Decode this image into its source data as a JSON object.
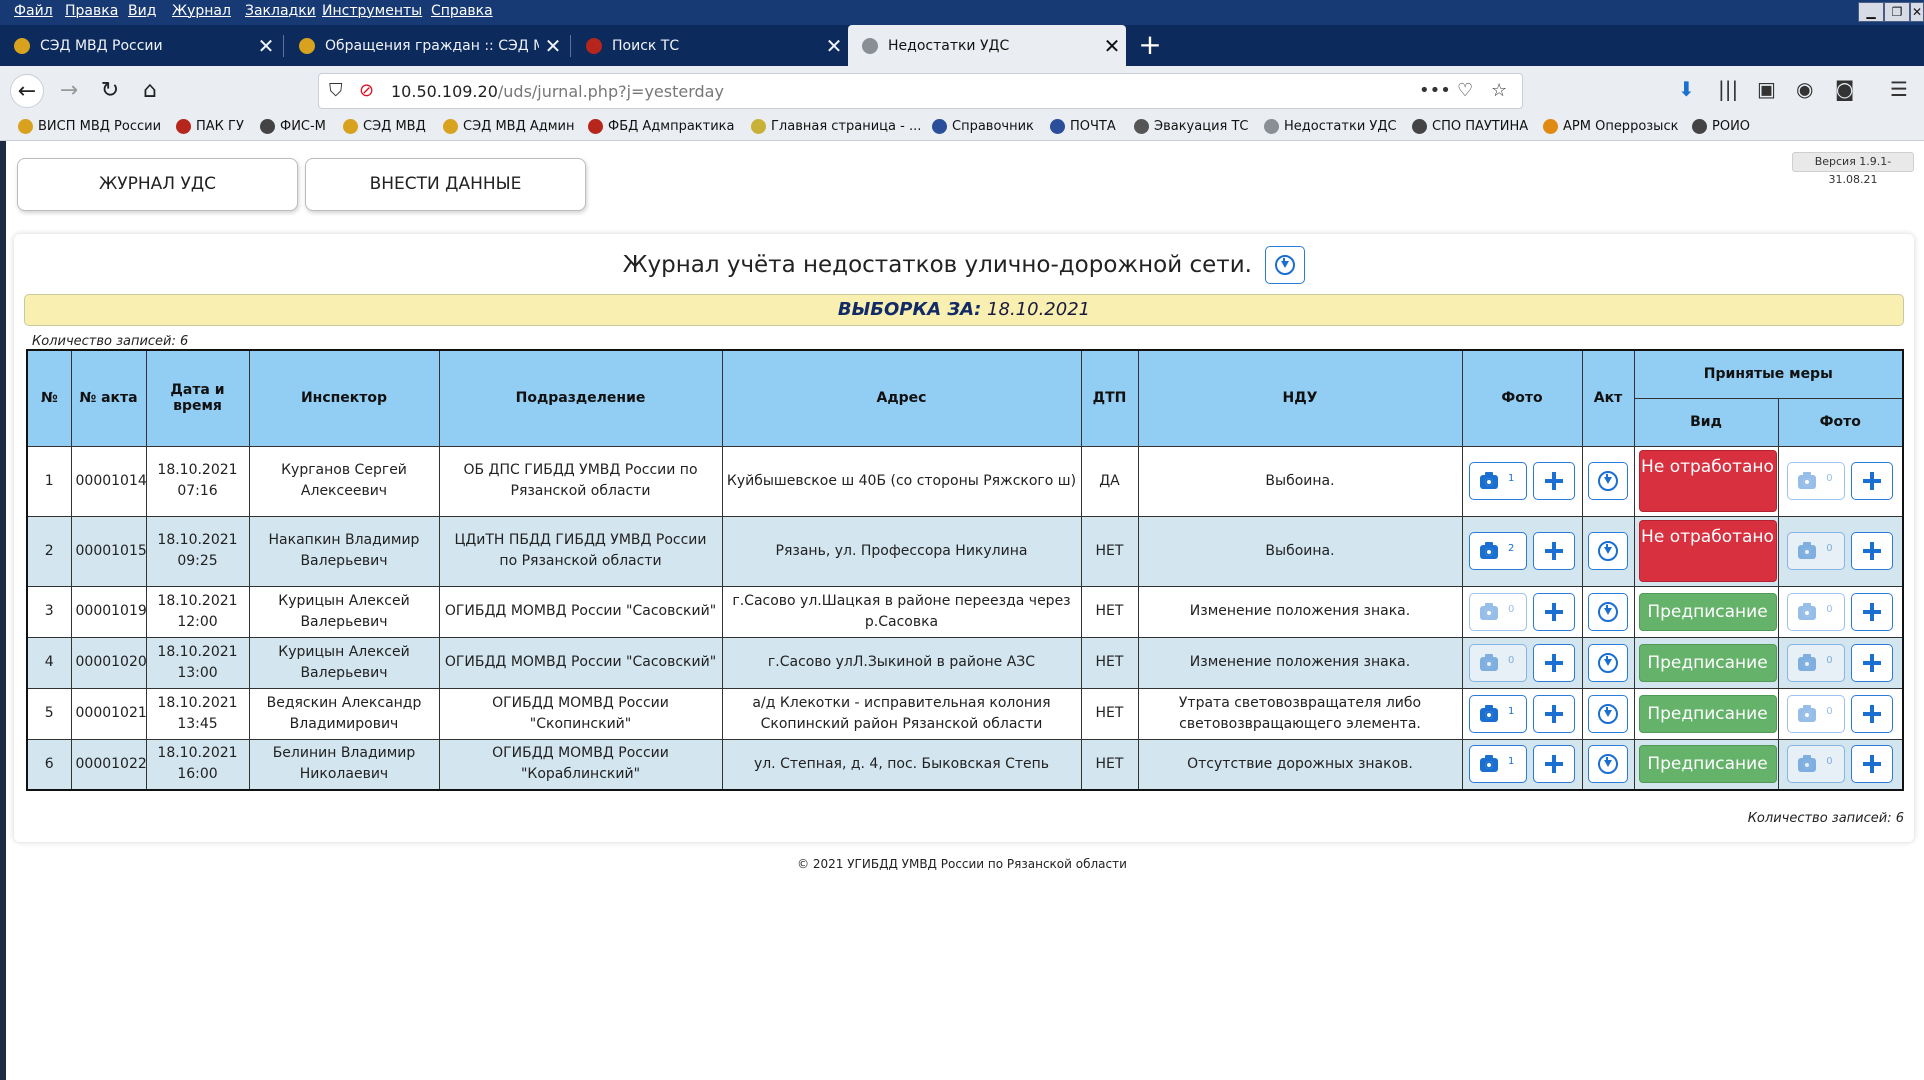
{
  "browser": {
    "menu": [
      "Файл",
      "Правка",
      "Вид",
      "Журнал",
      "Закладки",
      "Инструменты",
      "Справка"
    ],
    "tabs": [
      {
        "label": "СЭД МВД России",
        "icon": "emblem-icon"
      },
      {
        "label": "Обращения граждан :: СЭД МВД",
        "icon": "emblem-icon"
      },
      {
        "label": "Поиск ТС",
        "icon": "emblem-icon"
      },
      {
        "label": "Недостатки УДС",
        "icon": "road-icon"
      }
    ],
    "active_tab": 3,
    "url_host": "10.50.109.20",
    "url_path": "/uds/jurnal.php?j=yesterday",
    "bookmarks": [
      "ВИСП МВД России",
      "ПАК ГУ",
      "ФИС-М",
      "СЭД МВД",
      "СЭД МВД Админ",
      "ФБД Адмпрактика",
      "Главная страница - ...",
      "Справочник",
      "ПОЧТА",
      "Эвакуация ТС",
      "Недостатки УДС",
      "СПО ПАУТИНА",
      "АРМ Оперрозыск",
      "РОИО"
    ]
  },
  "page": {
    "version": "Версия 1.9.1-31.08.21",
    "nav_buttons": [
      "ЖУРНАЛ УДС",
      "ВНЕСТИ ДАННЫЕ"
    ],
    "title": "Журнал учёта недостатков улично-дорожной сети.",
    "period_label": "ВЫБОРКА ЗА:",
    "period_date": "18.10.2021",
    "count_text": "Количество записей: 6",
    "footer": "© 2021 УГИБДД УМВД России по Рязанской области"
  },
  "table": {
    "headers": {
      "num": "№",
      "act_no": "№ акта",
      "datetime": "Дата и время",
      "inspector": "Инспектор",
      "division": "Подразделение",
      "address": "Адрес",
      "dtp": "ДТП",
      "ndu": "НДУ",
      "photo": "Фото",
      "act": "Акт",
      "measures": "Принятые меры",
      "measures_kind": "Вид",
      "measures_photo": "Фото"
    },
    "rows": [
      {
        "num": "1",
        "act_no": "00001014",
        "date": "18.10.2021",
        "time": "07:16",
        "inspector": "Курганов Сергей Алексеевич",
        "division": "ОБ ДПС ГИБДД УМВД России по Рязанской области",
        "address": "Куйбышевское ш 40Б (со стороны Ряжского ш)",
        "dtp": "ДА",
        "ndu": "Выбоина.",
        "photo_count": "1",
        "status": "Не отработано",
        "status_kind": "red",
        "mphoto_count": "0"
      },
      {
        "num": "2",
        "act_no": "00001015",
        "date": "18.10.2021",
        "time": "09:25",
        "inspector": "Накапкин Владимир Валерьевич",
        "division": "ЦДиТН ПБДД ГИБДД УМВД России по Рязанской области",
        "address": "Рязань, ул. Профессора Никулина",
        "dtp": "НЕТ",
        "ndu": "Выбоина.",
        "photo_count": "2",
        "status": "Не отработано",
        "status_kind": "red",
        "mphoto_count": "0"
      },
      {
        "num": "3",
        "act_no": "00001019",
        "date": "18.10.2021",
        "time": "12:00",
        "inspector": "Курицын Алексей Валерьевич",
        "division": "ОГИБДД МОМВД России \"Сасовский\"",
        "address": "г.Сасово ул.Шацкая в районе переезда через р.Сасовка",
        "dtp": "НЕТ",
        "ndu": "Изменение положения знака.",
        "photo_count": "0",
        "status": "Предписание",
        "status_kind": "green",
        "mphoto_count": "0"
      },
      {
        "num": "4",
        "act_no": "00001020",
        "date": "18.10.2021",
        "time": "13:00",
        "inspector": "Курицын Алексей Валерьевич",
        "division": "ОГИБДД МОМВД России \"Сасовский\"",
        "address": "г.Сасово улЛ.Зыкиной в районе АЗС",
        "dtp": "НЕТ",
        "ndu": "Изменение положения знака.",
        "photo_count": "0",
        "status": "Предписание",
        "status_kind": "green",
        "mphoto_count": "0"
      },
      {
        "num": "5",
        "act_no": "00001021",
        "date": "18.10.2021",
        "time": "13:45",
        "inspector": "Ведяскин Александр Владимирович",
        "division": "ОГИБДД МОМВД России \"Скопинский\"",
        "address": "а/д Клекотки - исправительная колония Скопинский район Рязанской области",
        "dtp": "НЕТ",
        "ndu": "Утрата световозвращателя либо световозвращающего элемента.",
        "photo_count": "1",
        "status": "Предписание",
        "status_kind": "green",
        "mphoto_count": "0"
      },
      {
        "num": "6",
        "act_no": "00001022",
        "date": "18.10.2021",
        "time": "16:00",
        "inspector": "Белинин Владимир Николаевич",
        "division": "ОГИБДД МОМВД России \"Кораблинский\"",
        "address": "ул. Степная, д. 4, пос. Быковская Степь",
        "dtp": "НЕТ",
        "ndu": "Отсутствие дорожных знаков.",
        "photo_count": "1",
        "status": "Предписание",
        "status_kind": "green",
        "mphoto_count": "0"
      }
    ]
  },
  "colors": {
    "header_bg": "#92cdf3",
    "alt_row_bg": "#d3e5ef",
    "period_bg": "#f8efb0",
    "status_red": "#d9303f",
    "status_green": "#65b36a",
    "accent_blue": "#1a6fd0"
  }
}
